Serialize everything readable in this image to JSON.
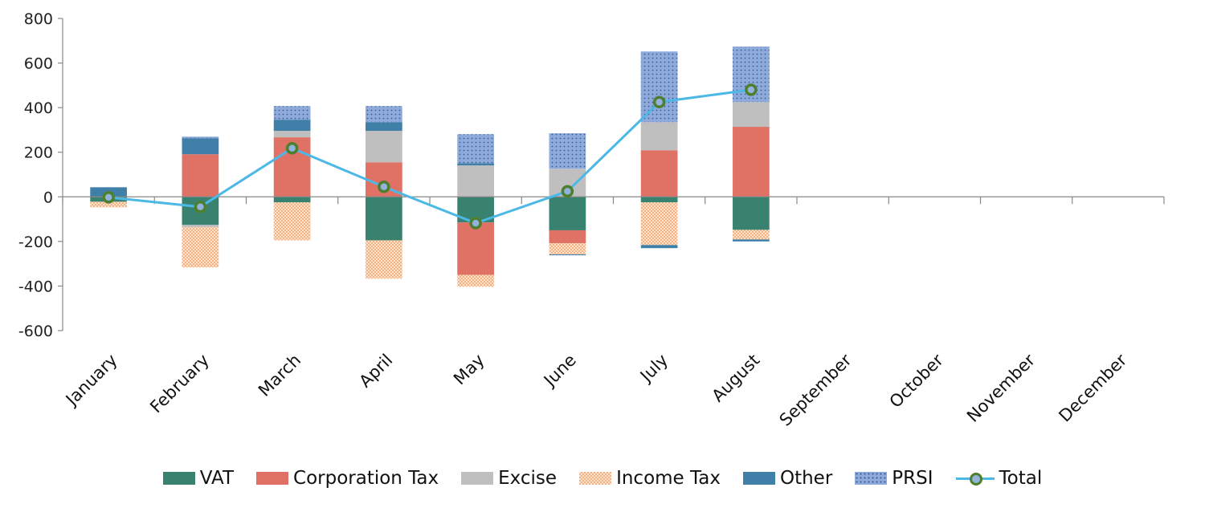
{
  "chart_data": {
    "type": "bar",
    "stacked": true,
    "title": "",
    "xlabel": "",
    "ylabel": "",
    "ylim": [
      -600,
      800
    ],
    "yticks": [
      -600,
      -400,
      -200,
      0,
      200,
      400,
      600,
      800
    ],
    "grid": false,
    "legend_position": "bottom",
    "categories": [
      "January",
      "February",
      "March",
      "April",
      "May",
      "June",
      "July",
      "August",
      "September",
      "October",
      "November",
      "December"
    ],
    "series": [
      {
        "name": "VAT",
        "kind": "bar",
        "color": "#3a8270",
        "pattern": "solid",
        "values": [
          -22,
          -126,
          -25,
          -195,
          -115,
          -150,
          -25,
          -148,
          null,
          null,
          null,
          null
        ]
      },
      {
        "name": "Corporation Tax",
        "kind": "bar",
        "color": "#df7264",
        "pattern": "solid",
        "values": [
          0,
          191,
          267,
          155,
          -235,
          -58,
          209,
          314,
          null,
          null,
          null,
          null
        ]
      },
      {
        "name": "Excise",
        "kind": "bar",
        "color": "#bfbfbf",
        "pattern": "solid",
        "values": [
          0,
          -10,
          29,
          141,
          141,
          126,
          126,
          111,
          null,
          null,
          null,
          null
        ]
      },
      {
        "name": "Income Tax",
        "kind": "bar",
        "color": "#f4b183",
        "pattern": "checker",
        "values": [
          -25,
          -180,
          -170,
          -172,
          -53,
          -50,
          -191,
          -43,
          null,
          null,
          null,
          null
        ]
      },
      {
        "name": "Other",
        "kind": "bar",
        "color": "#3f7fa8",
        "pattern": "solid",
        "values": [
          43,
          72,
          50,
          39,
          10,
          -4,
          -14,
          -9,
          null,
          null,
          null,
          null
        ]
      },
      {
        "name": "PRSI",
        "kind": "bar",
        "color": "#8eaadb",
        "pattern": "dots",
        "values": [
          0,
          7,
          61,
          72,
          130,
          159,
          317,
          249,
          null,
          null,
          null,
          null
        ]
      },
      {
        "name": "Total",
        "kind": "line",
        "color": "#4cb8e6",
        "marker_edge": "#4e7f2e",
        "marker_fill": "#93b3dc",
        "values": [
          -2,
          -45,
          218,
          45,
          -118,
          25,
          425,
          480,
          null,
          null,
          null,
          null
        ]
      }
    ]
  }
}
